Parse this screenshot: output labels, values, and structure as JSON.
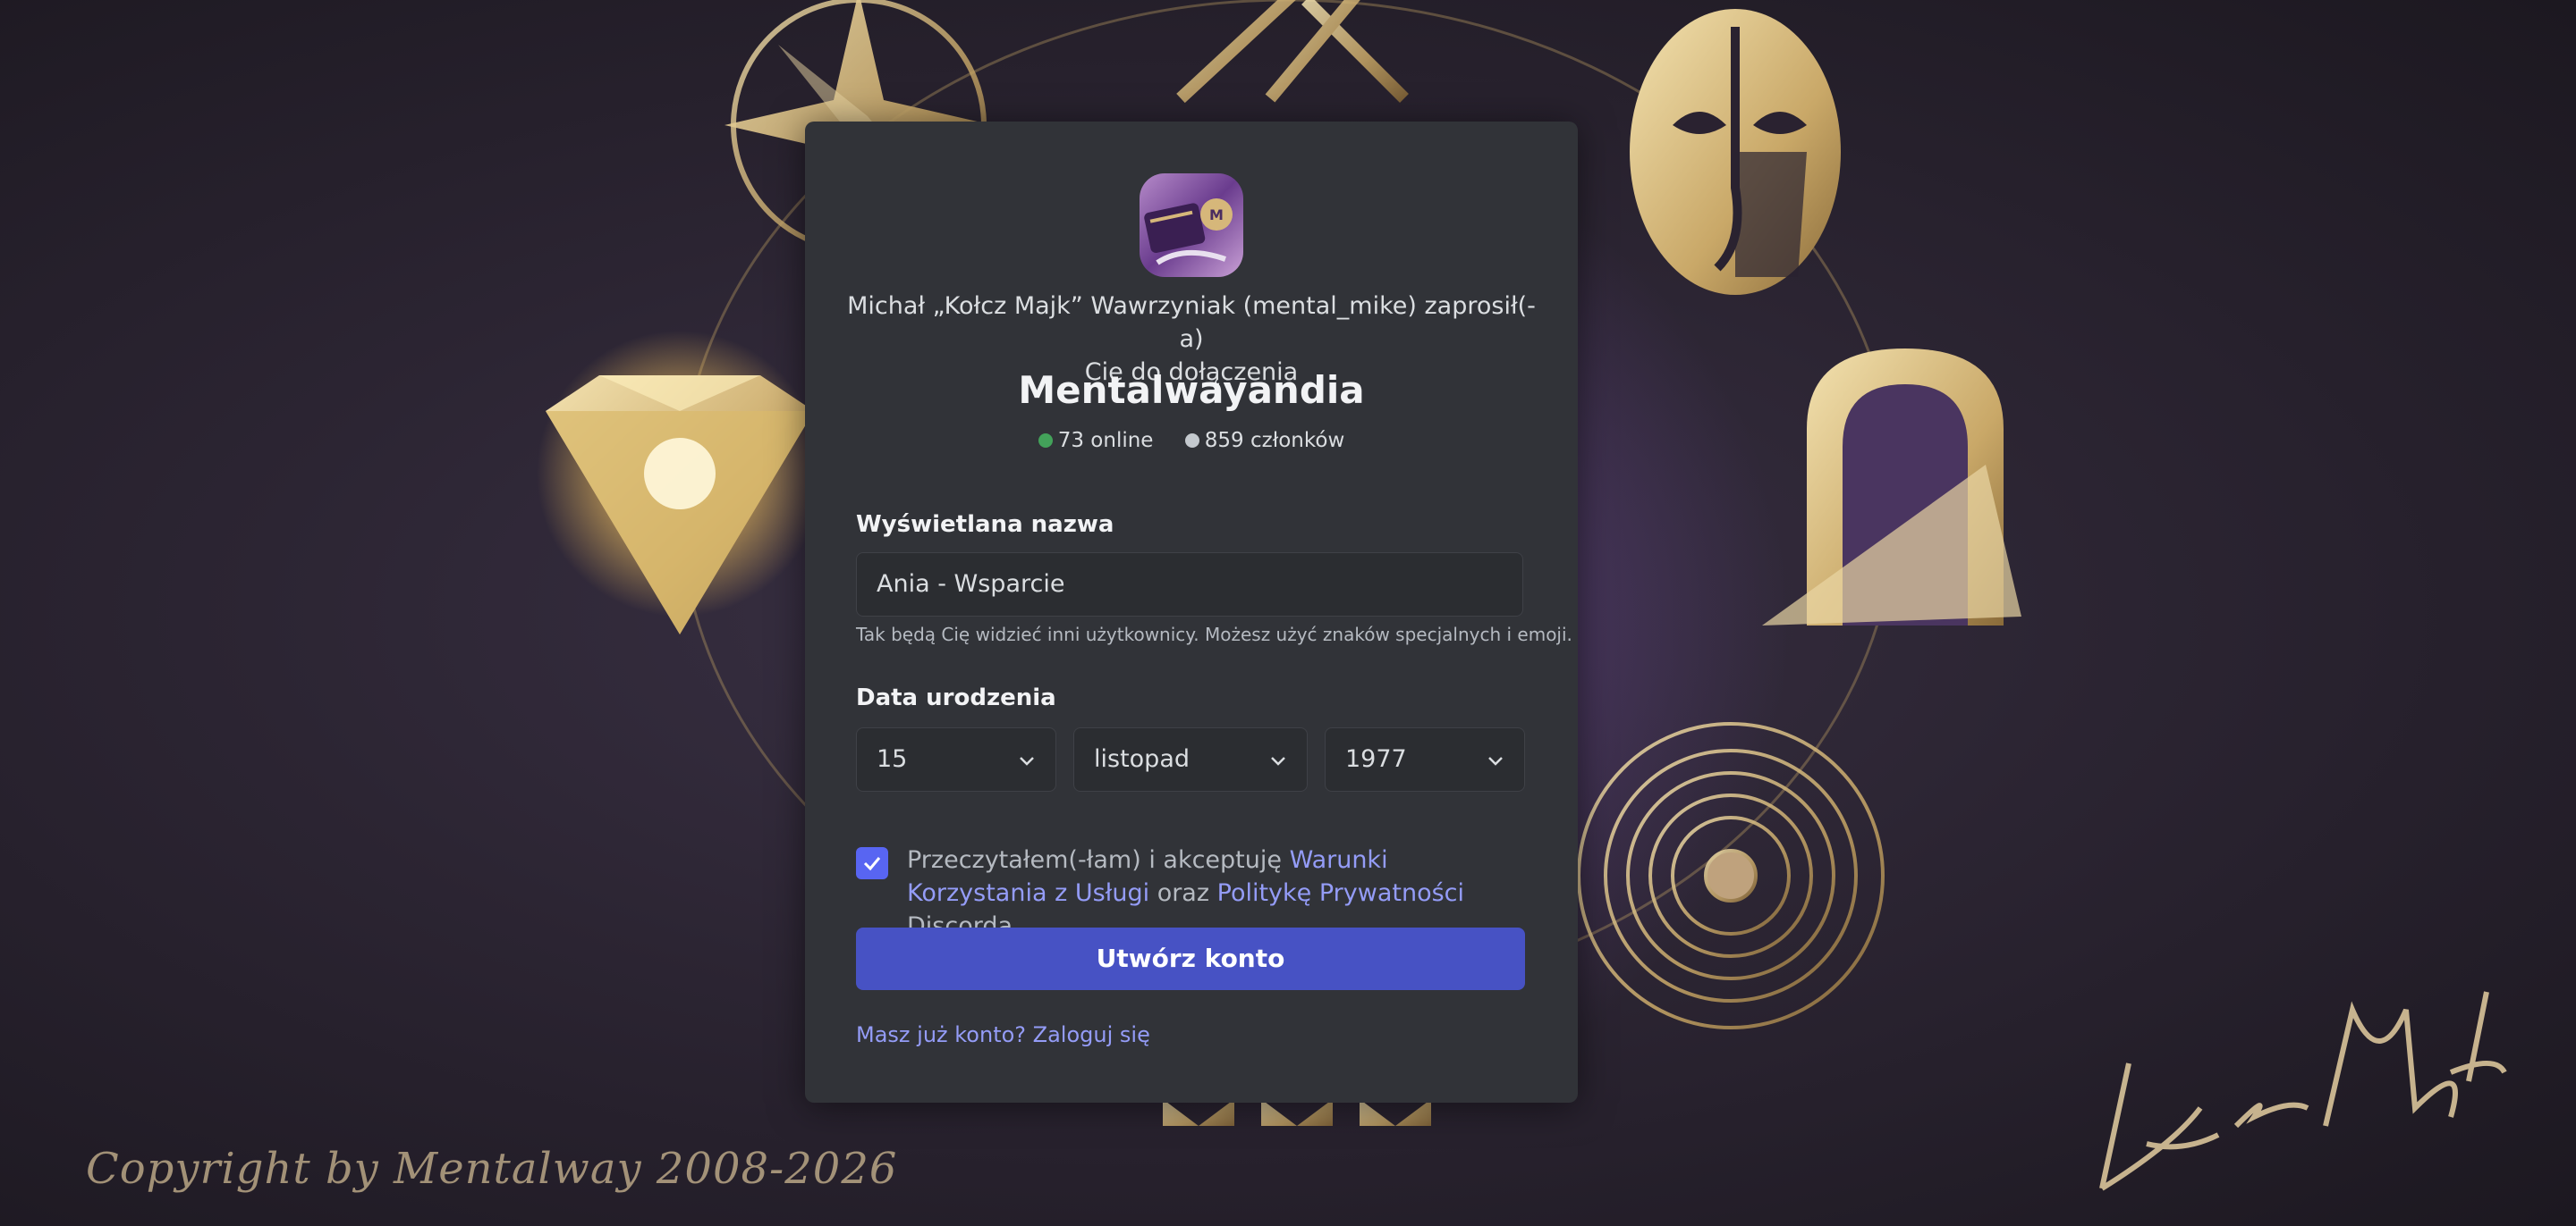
{
  "background": {
    "copyright": "Copyright by Mentalway 2008-2026",
    "accent_gold": "#d6b77a"
  },
  "invite": {
    "inviter_line1": "Michał „Kołcz Majk” Wawrzyniak (mental_mike) zaprosił(-a)",
    "inviter_line2": "Cię do dołączenia",
    "server_name": "Mentalwayandia",
    "online": "73 online",
    "members": "859 członków",
    "server_icon": "server-avatar-image"
  },
  "form": {
    "display_name_label": "Wyświetlana nazwa",
    "display_name_value": "Ania - Wsparcie",
    "display_name_hint": "Tak będą Cię widzieć inni użytkownicy. Możesz użyć znaków specjalnych i emoji.",
    "birthdate_label": "Data urodzenia",
    "day": "15",
    "month": "listopad",
    "year": "1977",
    "terms_checked": true,
    "terms_prefix": "Przeczytałem(-łam) i akceptuję",
    "terms_link": "Warunki Korzystania z Usługi",
    "terms_mid": "oraz",
    "privacy_link": "Politykę Prywatności",
    "terms_suffix": "Discorda.",
    "submit": "Utwórz konto",
    "login_link": "Masz już konto? Zaloguj się"
  },
  "colors": {
    "card": "#313338",
    "button": "#4752c4",
    "link": "#949cf7",
    "checkbox": "#5865f2",
    "online": "#43a25a"
  }
}
